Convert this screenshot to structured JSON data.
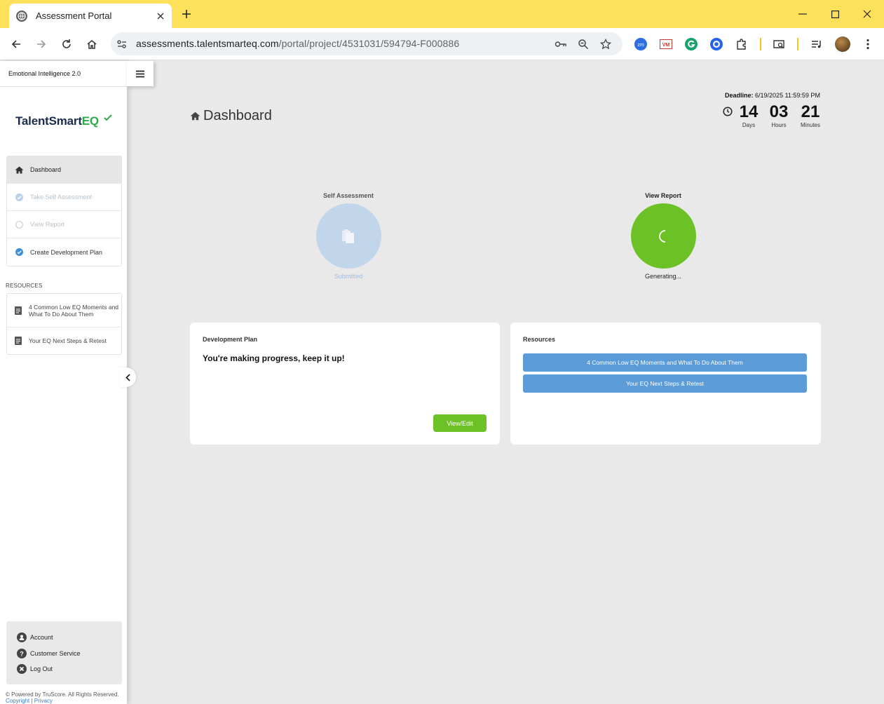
{
  "browser": {
    "tab_title": "Assessment Portal",
    "url_host": "assessments.talentsmarteq.com",
    "url_path": "/portal/project/4531031/594794-F000886"
  },
  "sidebar": {
    "product_title": "Emotional Intelligence 2.0",
    "logo_text_a": "TalentSmart",
    "logo_text_b": "EQ",
    "nav": [
      {
        "label": "Dashboard"
      },
      {
        "label": "Take Self Assessment"
      },
      {
        "label": "View Report"
      },
      {
        "label": "Create Development Plan"
      }
    ],
    "resources_heading": "RESOURCES",
    "resources": [
      {
        "label": "4 Common Low EQ Moments and What To Do About Them"
      },
      {
        "label": "Your EQ Next Steps & Retest"
      }
    ],
    "account": [
      {
        "label": "Account"
      },
      {
        "label": "Customer Service"
      },
      {
        "label": "Log Out"
      }
    ],
    "footer_text": "© Powered by TruScore. All Rights Reserved.",
    "footer_link_copyright": "Copyright",
    "footer_sep": " | ",
    "footer_link_privacy": "Privacy"
  },
  "main": {
    "title": "Dashboard",
    "deadline_label": "Deadline:",
    "deadline_value": "6/19/2025 11:59:59 PM",
    "countdown": [
      {
        "value": "14",
        "label": "Days"
      },
      {
        "value": "03",
        "label": "Hours"
      },
      {
        "value": "21",
        "label": "Minutes"
      }
    ],
    "steps": [
      {
        "title": "Self Assessment",
        "status": "Submitted"
      },
      {
        "title": "View Report",
        "status": "Generating..."
      }
    ],
    "dev_plan": {
      "title": "Development Plan",
      "message": "You're making progress, keep it up!",
      "button": "View/Edit"
    },
    "resources_panel": {
      "title": "Resources",
      "buttons": [
        "4 Common Low EQ Moments and What To Do About Them",
        "Your EQ Next Steps & Retest"
      ]
    }
  },
  "colors": {
    "chrome_yellow": "#fde15a",
    "green": "#6cc126",
    "blue_button": "#5a9bd8",
    "submitted_blue": "#c2d6eb"
  }
}
